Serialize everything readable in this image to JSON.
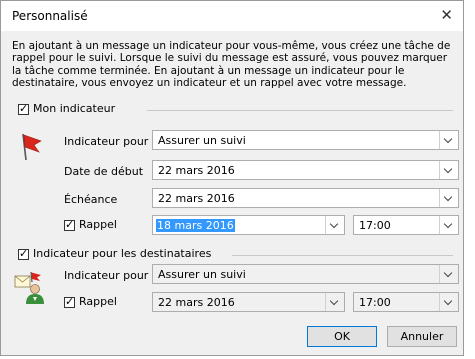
{
  "dialog": {
    "title": "Personnalisé",
    "close_glyph": "✕",
    "intro": "En ajoutant à un message un indicateur pour vous-même, vous créez une tâche de rappel pour le suivi. Lorsque le suivi du message est assuré, vous pouvez marquer la tâche comme terminée. En ajoutant à un message un indicateur pour le destinataire, vous envoyez un indicateur et un rappel avec votre message."
  },
  "my_flag": {
    "checkbox_label": "Mon indicateur",
    "checked": true,
    "icon": "red-flag-icon",
    "flag_to_label": "Indicateur pour",
    "flag_to_value": "Assurer un suivi",
    "start_label": "Date de début",
    "start_value": "22 mars 2016",
    "due_label": "Échéance",
    "due_value": "22 mars 2016",
    "reminder_label": "Rappel",
    "reminder_checked": true,
    "reminder_date": "18 mars 2016",
    "reminder_time": "17:00"
  },
  "recipients_flag": {
    "checkbox_label": "Indicateur pour les destinataires",
    "checked": true,
    "icon": "recipient-flag-icon",
    "flag_to_label": "Indicateur pour",
    "flag_to_value": "Assurer un suivi",
    "reminder_label": "Rappel",
    "reminder_checked": true,
    "reminder_date": "22 mars 2016",
    "reminder_time": "17:00"
  },
  "buttons": {
    "ok": "OK",
    "cancel": "Annuler"
  },
  "background_cut_text": "or",
  "colors": {
    "selection": "#3399ff",
    "flag_red": "#d9261c",
    "ok_border": "#0078d7"
  }
}
